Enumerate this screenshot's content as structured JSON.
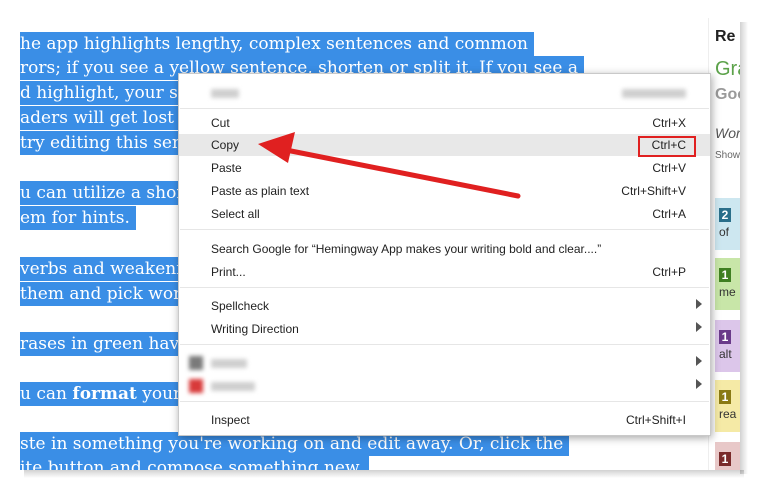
{
  "editor": {
    "lines": [
      "he app highlights lengthy, complex sentences and common",
      "rors; if you see a yellow sentence, shorten or split it. If you see a",
      "d highlight, your sentence is so dense and complicated that your",
      "aders will get lost trying to follow its meandering, splitting logic —",
      " try editing this sentence to remove the red.",
      "u can utilize a shorter word in place of a purple one. Mouse over",
      "em for hints.",
      "verbs and weakening phrases are helpfully shown in blue. Get rid of",
      " them and pick words with force, perhaps.",
      "rases in green have been marked to show passive voice.",
      "u can format your text with the toolbar.",
      "ste in something you're working on and edit away. Or, click the",
      "ite button and compose something new."
    ],
    "bold_word": "format"
  },
  "sidebar": {
    "title": "Re",
    "grade": "Gra",
    "good": "Goo",
    "words": "Wor",
    "show": "Show",
    "cards": [
      {
        "num": "2",
        "sub": "of",
        "bg": "#cde7f0",
        "num_bg": "#2b6f8a"
      },
      {
        "num": "1",
        "sub": "me",
        "bg": "#c8e6a8",
        "num_bg": "#3f7f22"
      },
      {
        "num": "1",
        "sub": "alt",
        "bg": "#dcc6ea",
        "num_bg": "#6a3a8a"
      },
      {
        "num": "1",
        "sub": "rea",
        "bg": "#f5eaa6",
        "num_bg": "#8a7a14"
      },
      {
        "num": "1",
        "sub": "",
        "bg": "#e8c8c8",
        "num_bg": "#7a2a2a"
      }
    ]
  },
  "context_menu": {
    "items": [
      {
        "label": "Cut",
        "shortcut": "Ctrl+X"
      },
      {
        "label": "Copy",
        "shortcut": "Ctrl+C",
        "highlighted": true
      },
      {
        "label": "Paste",
        "shortcut": "Ctrl+V"
      },
      {
        "label": "Paste as plain text",
        "shortcut": "Ctrl+Shift+V"
      },
      {
        "label": "Select all",
        "shortcut": "Ctrl+A"
      },
      {
        "label": "Search Google for “Hemingway App makes your writing bold and clear....”",
        "shortcut": ""
      },
      {
        "label": "Print...",
        "shortcut": "Ctrl+P"
      },
      {
        "label": "Spellcheck",
        "shortcut": "",
        "submenu": true
      },
      {
        "label": "Writing Direction",
        "shortcut": "",
        "submenu": true
      },
      {
        "label": "Inspect",
        "shortcut": "Ctrl+Shift+I"
      }
    ]
  },
  "annotation": {
    "arrow_color": "#e02020",
    "box_color": "#e02020",
    "selection_color": "#3a8ee6"
  }
}
